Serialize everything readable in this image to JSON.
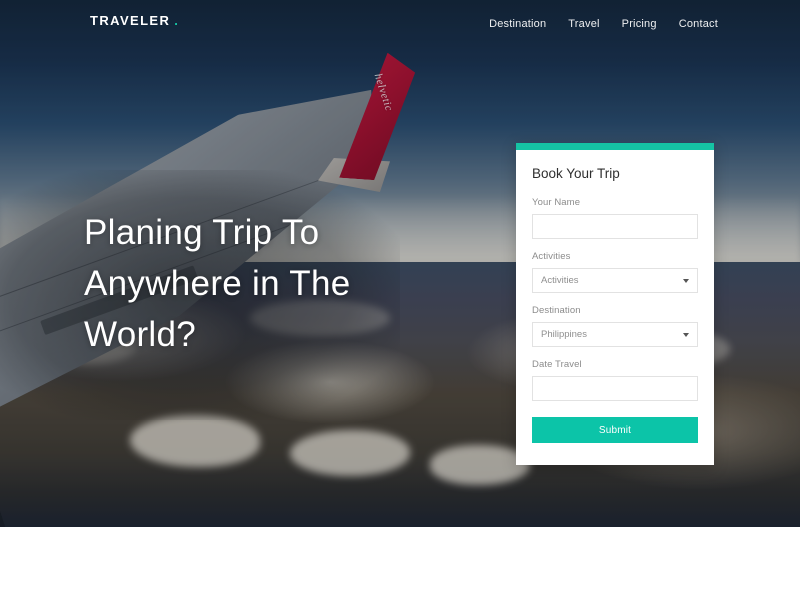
{
  "site": {
    "logo_text": "TRAVELER",
    "logo_dot": ".",
    "accent_color": "#15c3a4",
    "submit_color": "#0cc4a8"
  },
  "nav": {
    "items": [
      {
        "label": "Destination"
      },
      {
        "label": "Travel"
      },
      {
        "label": "Pricing"
      },
      {
        "label": "Contact"
      }
    ]
  },
  "hero": {
    "heading": "Planing Trip To Anywhere in The World?",
    "image_description": "airplane-wing-over-mountains",
    "winglet_brand": "helvetic"
  },
  "booking_form": {
    "title": "Book Your Trip",
    "fields": [
      {
        "label": "Your Name",
        "type": "text",
        "value": "",
        "placeholder": ""
      },
      {
        "label": "Activities",
        "type": "select",
        "value": "Activities"
      },
      {
        "label": "Destination",
        "type": "select",
        "value": "Philippines"
      },
      {
        "label": "Date Travel",
        "type": "text",
        "value": "",
        "placeholder": ""
      }
    ],
    "submit_label": "Submit"
  }
}
